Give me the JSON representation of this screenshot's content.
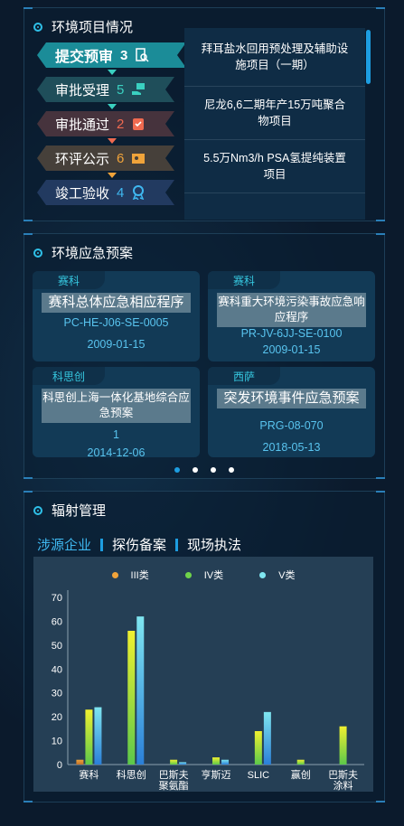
{
  "env_projects": {
    "title": "环境项目情况",
    "steps": [
      {
        "label": "提交预审",
        "count": "3",
        "icon": "document-search-icon",
        "bg": "#1b8c98",
        "count_color": "#ffffff",
        "arrow": "#3ad0c0"
      },
      {
        "label": "审批受理",
        "count": "5",
        "icon": "hand-card-icon",
        "bg": "#1f4e5a",
        "count_color": "#3ad0c0",
        "arrow": "#3ad0c0"
      },
      {
        "label": "审批通过",
        "count": "2",
        "icon": "clipboard-check-icon",
        "bg": "#46333d",
        "count_color": "#ef6a50",
        "arrow": "#ef6a50"
      },
      {
        "label": "环评公示",
        "count": "6",
        "icon": "map-book-icon",
        "bg": "#46403a",
        "count_color": "#f0a33a",
        "arrow": "#f0a33a"
      },
      {
        "label": "竣工验收",
        "count": "4",
        "icon": "award-badge-icon",
        "bg": "#223a60",
        "count_color": "#3fb8f0",
        "arrow": ""
      }
    ],
    "projects": [
      "拜耳盐水回用预处理及辅助设施项目（一期）",
      "尼龙6,6二期年产15万吨聚合物项目",
      "5.5万Nm3/h PSA氢提纯装置项目"
    ]
  },
  "emergency": {
    "title": "环境应急预案",
    "cards": [
      {
        "company": "赛科",
        "name": "赛科总体应急相应程序",
        "code": "PC-HE-J06-SE-0005",
        "date": "2009-01-15"
      },
      {
        "company": "赛科",
        "name": "赛科重大环境污染事故应急响应程序",
        "code": "PR-JV-6JJ-SE-0100",
        "date": "2009-01-15"
      },
      {
        "company": "科思创",
        "name": "科思创上海一体化基地综合应急预案",
        "code": "1",
        "date": "2014-12-06"
      },
      {
        "company": "西萨",
        "name": "突发环境事件应急预案",
        "code": "PRG-08-070",
        "date": "2018-05-13"
      }
    ]
  },
  "radiation": {
    "title": "辐射管理",
    "tabs": [
      "涉源企业",
      "探伤备案",
      "现场执法"
    ]
  },
  "chart_data": {
    "type": "bar",
    "categories": [
      "赛科",
      "科思创",
      "巴斯夫聚氨酯",
      "亨斯迈",
      "SLIC",
      "赢创",
      "巴斯夫涂料"
    ],
    "category_lines": [
      [
        "赛科"
      ],
      [
        "科思创"
      ],
      [
        "巴斯夫",
        "聚氨酯"
      ],
      [
        "亨斯迈"
      ],
      [
        "SLIC"
      ],
      [
        "赢创"
      ],
      [
        "巴斯夫",
        "涂料"
      ]
    ],
    "series": [
      {
        "name": "III类",
        "values": [
          2,
          0,
          0,
          0,
          0,
          0,
          0
        ],
        "color": "#f0a33a"
      },
      {
        "name": "IV类",
        "values": [
          23,
          56,
          2,
          3,
          14,
          2,
          16
        ],
        "color": "#6fd34a"
      },
      {
        "name": "V类",
        "values": [
          24,
          62,
          1,
          2,
          22,
          0,
          0
        ],
        "color": "#7fe6f0"
      }
    ],
    "yticks": [
      "0",
      "10",
      "20",
      "30",
      "40",
      "50",
      "60",
      "70"
    ],
    "ylim": [
      0,
      70
    ],
    "legend_position": "top"
  }
}
